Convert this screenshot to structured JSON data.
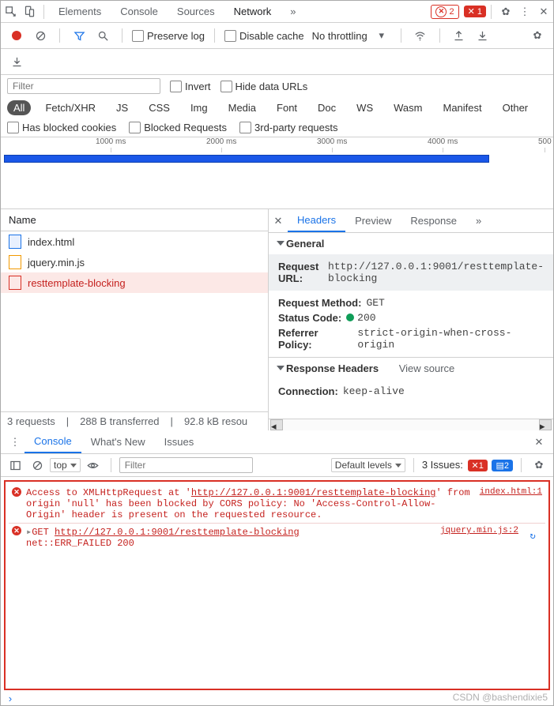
{
  "tabs": {
    "elements": "Elements",
    "console": "Console",
    "sources": "Sources",
    "network": "Network",
    "more": "»"
  },
  "counts": {
    "err_outline": "2",
    "err_fill": "1"
  },
  "toolbar": {
    "preserve": "Preserve log",
    "disable": "Disable cache",
    "throttle": "No throttling"
  },
  "filter": {
    "ph": "Filter",
    "invert": "Invert",
    "hidedata": "Hide data URLs"
  },
  "types": [
    "All",
    "Fetch/XHR",
    "JS",
    "CSS",
    "Img",
    "Media",
    "Font",
    "Doc",
    "WS",
    "Wasm",
    "Manifest",
    "Other"
  ],
  "cookies": {
    "blocked": "Has blocked cookies",
    "blockedreq": "Blocked Requests",
    "thirdparty": "3rd-party requests"
  },
  "timeline_ticks": [
    "1000 ms",
    "2000 ms",
    "3000 ms",
    "4000 ms",
    "500"
  ],
  "list_header": "Name",
  "requests": [
    {
      "name": "index.html",
      "icon": "blue"
    },
    {
      "name": "jquery.min.js",
      "icon": "yellow"
    },
    {
      "name": "resttemplate-blocking",
      "icon": "red",
      "sel": true
    }
  ],
  "status": {
    "reqs": "3 requests",
    "trans": "288 B transferred",
    "res": "92.8 kB resou"
  },
  "det_tabs": {
    "headers": "Headers",
    "preview": "Preview",
    "response": "Response",
    "more": "»"
  },
  "general": {
    "title": "General",
    "url_k": "Request URL:",
    "url_v": "http://127.0.0.1:9001/resttemplate-blocking",
    "method_k": "Request Method:",
    "method_v": "GET",
    "status_k": "Status Code:",
    "status_v": "200",
    "ref_k": "Referrer Policy:",
    "ref_v": "strict-origin-when-cross-origin"
  },
  "resp_headers": {
    "title": "Response Headers",
    "view": "View source",
    "conn_k": "Connection:",
    "conn_v": "keep-alive"
  },
  "drawer_tabs": {
    "console": "Console",
    "whatsnew": "What's New",
    "issues": "Issues"
  },
  "drawer_toolbar": {
    "top": "top",
    "filter_ph": "Filter",
    "levels": "Default levels",
    "issues": "3 Issues:",
    "i_red": "1",
    "i_blue": "2"
  },
  "console": [
    {
      "msg_a": "Access to XMLHttpRequest at '",
      "url1": "http://127.0.0.1:9001/resttemplate-blocking",
      "msg_b": "' from origin 'null' has been blocked by CORS policy: No 'Access-Control-Allow-Origin' header is present on the requested resource.",
      "src": "index.html:1"
    },
    {
      "pre": "GET ",
      "url": "http://127.0.0.1:9001/resttemplate-blocking",
      "post": "\nnet::ERR_FAILED 200",
      "src": "jquery.min.js:2"
    }
  ],
  "watermark": "CSDN @bashendixie5"
}
